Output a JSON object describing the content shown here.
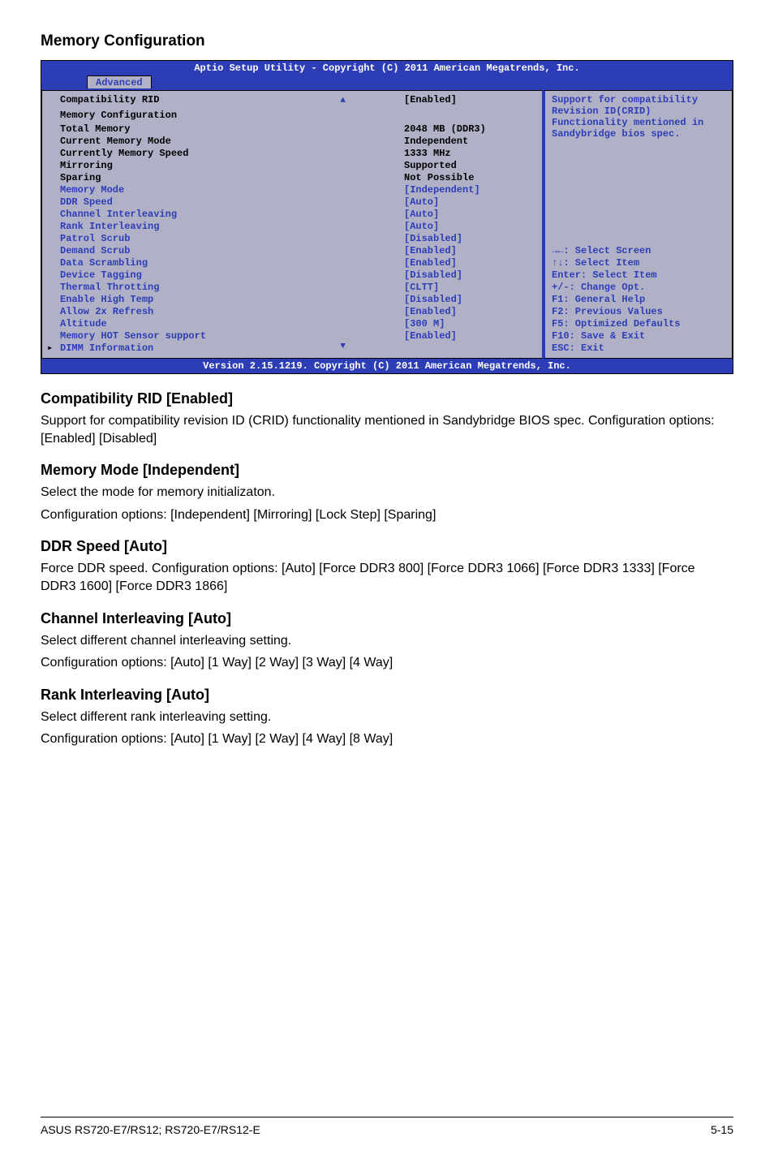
{
  "page": {
    "heading_1": "Memory Configuration",
    "heading_2": "Compatibility RID [Enabled]",
    "text_2": "Support for compatibility revision ID (CRID) functionality mentioned in Sandybridge BIOS spec. Configuration options: [Enabled] [Disabled]",
    "heading_3": "Memory Mode [Independent]",
    "text_3a": "Select the mode for memory initializaton.",
    "text_3b": "Configuration options: [Independent] [Mirroring] [Lock Step] [Sparing]",
    "heading_4": "DDR Speed [Auto]",
    "text_4": "Force DDR speed. Configuration options: [Auto] [Force DDR3 800] [Force DDR3 1066] [Force DDR3 1333] [Force DDR3 1600] [Force DDR3 1866]",
    "heading_5": "Channel Interleaving [Auto]",
    "text_5a": "Select different channel interleaving setting.",
    "text_5b": "Configuration options: [Auto] [1 Way] [2 Way] [3 Way] [4 Way]",
    "heading_6": "Rank Interleaving [Auto]",
    "text_6a": "Select different rank interleaving setting.",
    "text_6b": "Configuration options: [Auto] [1 Way] [2 Way] [4 Way] [8 Way]"
  },
  "bios": {
    "title": "Aptio Setup Utility - Copyright (C) 2011 American Megatrends, Inc.",
    "tab": "Advanced",
    "footer": "Version 2.15.1219. Copyright (C) 2011 American Megatrends, Inc.",
    "help": "Support for compatibility Revision ID(CRID) Functionality mentioned in Sandybridge bios spec.",
    "keys": {
      "k1": "→←: Select Screen",
      "k2": "↑↓:  Select Item",
      "k3": "Enter: Select Item",
      "k4": "+/-: Change Opt.",
      "k5": "F1: General Help",
      "k6": "F2: Previous Values",
      "k7": "F5: Optimized Defaults",
      "k8": "F10: Save & Exit",
      "k9": "ESC: Exit"
    },
    "rows": [
      {
        "label": "Compatibility RID",
        "value": "[Enabled]",
        "type": "static"
      },
      {
        "label": "Memory Configuration",
        "value": "",
        "type": "heading"
      },
      {
        "label": "Total Memory",
        "value": "2048 MB (DDR3)",
        "type": "static"
      },
      {
        "label": "Current Memory Mode",
        "value": "Independent",
        "type": "static"
      },
      {
        "label": "Currently Memory Speed",
        "value": "1333 MHz",
        "type": "static"
      },
      {
        "label": "Mirroring",
        "value": "Supported",
        "type": "static"
      },
      {
        "label": "Sparing",
        "value": "Not Possible",
        "type": "static"
      },
      {
        "label": "Memory Mode",
        "value": "[Independent]",
        "type": "selectable"
      },
      {
        "label": "DDR Speed",
        "value": "[Auto]",
        "type": "selectable"
      },
      {
        "label": "Channel Interleaving",
        "value": "[Auto]",
        "type": "selectable"
      },
      {
        "label": "Rank Interleaving",
        "value": "[Auto]",
        "type": "selectable"
      },
      {
        "label": "Patrol Scrub",
        "value": "[Disabled]",
        "type": "selectable"
      },
      {
        "label": "Demand Scrub",
        "value": "[Enabled]",
        "type": "selectable"
      },
      {
        "label": "Data Scrambling",
        "value": "[Enabled]",
        "type": "selectable"
      },
      {
        "label": "Device Tagging",
        "value": "[Disabled]",
        "type": "selectable"
      },
      {
        "label": "Thermal Throtting",
        "value": "[CLTT]",
        "type": "selectable"
      },
      {
        "label": "Enable High Temp",
        "value": "[Disabled]",
        "type": "selectable"
      },
      {
        "label": "Allow 2x Refresh",
        "value": "[Enabled]",
        "type": "selectable"
      },
      {
        "label": "Altitude",
        "value": "[300 M]",
        "type": "selectable"
      },
      {
        "label": "Memory HOT Sensor support",
        "value": "[Enabled]",
        "type": "selectable"
      },
      {
        "label": "DIMM Information",
        "value": "",
        "type": "submenu"
      }
    ]
  },
  "footer": {
    "left": "ASUS RS720-E7/RS12; RS720-E7/RS12-E",
    "right": "5-15"
  }
}
